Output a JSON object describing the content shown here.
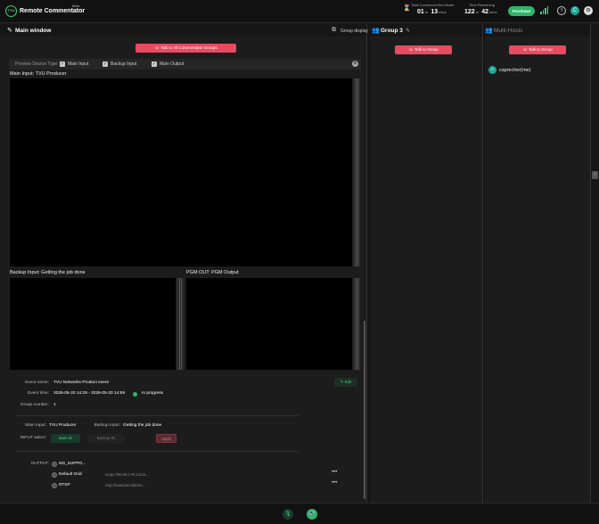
{
  "app": {
    "title": "Remote Commentator",
    "beta": "Beta",
    "logo_text": "TVU"
  },
  "stats": {
    "consumed_label": "Total Consumed this Month",
    "consumed_days": "01",
    "consumed_hours_unit": "hr",
    "consumed_hours": "13",
    "consumed_mins_unit": "mins",
    "remaining_label": "Time Remaining",
    "remaining_hours": "122",
    "remaining_hours_unit": "hr",
    "remaining_mins": "42",
    "remaining_mins_unit": "mins"
  },
  "topbar": {
    "purchase_label": "Purchase",
    "help_icon": "?",
    "avatar_letter": "C"
  },
  "main_window": {
    "title": "Main window",
    "group_display_label": "Group display",
    "talk_all_label": "Talk to All Commentator Groups",
    "preview_source_label": "Preview Source Type:",
    "preview_options": [
      "Main Input",
      "Backup Input",
      "Main Output"
    ],
    "main_input_label": "Main Input: TVU Producer",
    "backup_input_label": "Backup Input: Getting the job done",
    "pgm_out_label": "PGM OUT: PGM Output",
    "edit_label": "Edit",
    "event_name_label": "Event name:",
    "event_name": "TVU Networks Product event",
    "event_time_label": "Event time:",
    "event_time": "2026-05-20 14:29 - 2026-05-20 14:59",
    "event_status": "In progress",
    "group_number_label": "Group number:",
    "group_number": "1",
    "main_input_key": "Main Input:",
    "main_input_value": "TVU Producer",
    "backup_input_key": "Backup Input:",
    "backup_input_value": "Getting the job done",
    "input_select_label": "INPUT select:",
    "main_in_btn": "Main IN",
    "backup_in_btn": "Backup IN",
    "apply_btn": "Apply",
    "output_label": "OUTPUT:",
    "outputs": [
      {
        "name": "ND_SUPPO...",
        "url": ""
      },
      {
        "name": "Default Grid",
        "url": "tvupc://98.66.179.141:6..."
      },
      {
        "name": "RTSP",
        "url": "rtsp://wowzaec2demo..."
      }
    ]
  },
  "group3": {
    "title": "Group 3",
    "talk_label": "Talk to Group"
  },
  "multi_hosts": {
    "title": "Multi-Hosts",
    "talk_label": "Talk to Group",
    "member_initial": "c",
    "member_name": "csprecher(me)"
  },
  "colors": {
    "accent_green": "#2fb56a",
    "talk_red": "#e84a5f",
    "avatar_teal": "#1aa89a"
  }
}
